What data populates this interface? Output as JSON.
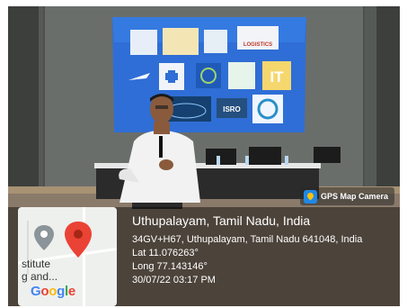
{
  "screen_tiles": [
    "LOGISTICS",
    "ISRO",
    "IT"
  ],
  "badge": {
    "icon": "map-pin-icon",
    "label": "GPS Map Camera"
  },
  "map": {
    "text_line1": "stitute",
    "text_line2": "g and...",
    "logo_parts": [
      "G",
      "o",
      "o",
      "g",
      "l",
      "e"
    ]
  },
  "location": {
    "title": "Uthupalayam, Tamil Nadu, India",
    "address": "34GV+H67, Uthupalayam, Tamil Nadu 641048, India",
    "lat": "Lat 11.076263°",
    "long": "Long 77.143146°",
    "datetime": "30/07/22 03:17 PM"
  },
  "colors": {
    "pin": "#ea4335",
    "map_bg": "#eef0ee"
  }
}
